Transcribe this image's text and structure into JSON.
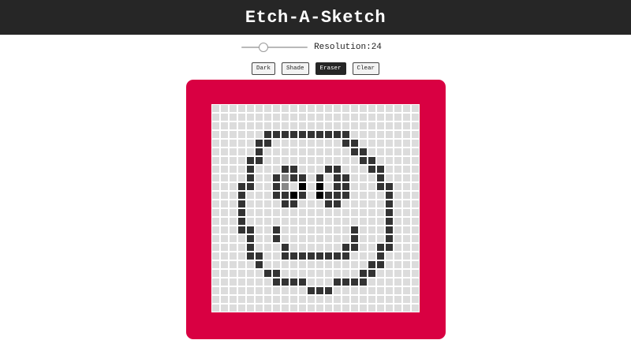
{
  "header": {
    "title": "Etch-A-Sketch"
  },
  "controls": {
    "resolution_label": "Resolution:",
    "resolution_value": "24",
    "resolution_level": 0.3
  },
  "modes": [
    {
      "id": "dark",
      "label": "Dark",
      "active": false
    },
    {
      "id": "shade",
      "label": "Shade",
      "active": false
    },
    {
      "id": "eraser",
      "label": "Eraser",
      "active": true
    },
    {
      "id": "clear",
      "label": "Clear",
      "active": false
    }
  ],
  "colors": {
    "header_bg": "#262626",
    "frame": "#d90042",
    "cell_empty": "#dcdcdc",
    "cell_dark": "#333333",
    "cell_black": "#000000",
    "cell_gray": "#888888"
  },
  "canvas": {
    "grid_size": 24,
    "painted": [
      [
        3,
        6,
        "#333333"
      ],
      [
        3,
        7,
        "#333333"
      ],
      [
        3,
        8,
        "#333333"
      ],
      [
        3,
        9,
        "#333333"
      ],
      [
        3,
        10,
        "#333333"
      ],
      [
        3,
        11,
        "#333333"
      ],
      [
        3,
        12,
        "#333333"
      ],
      [
        3,
        13,
        "#333333"
      ],
      [
        3,
        14,
        "#333333"
      ],
      [
        3,
        15,
        "#333333"
      ],
      [
        4,
        5,
        "#333333"
      ],
      [
        4,
        6,
        "#333333"
      ],
      [
        4,
        15,
        "#333333"
      ],
      [
        4,
        16,
        "#333333"
      ],
      [
        5,
        5,
        "#333333"
      ],
      [
        5,
        16,
        "#333333"
      ],
      [
        5,
        17,
        "#333333"
      ],
      [
        6,
        4,
        "#333333"
      ],
      [
        6,
        5,
        "#333333"
      ],
      [
        6,
        17,
        "#333333"
      ],
      [
        6,
        18,
        "#333333"
      ],
      [
        7,
        4,
        "#333333"
      ],
      [
        7,
        8,
        "#333333"
      ],
      [
        7,
        9,
        "#333333"
      ],
      [
        7,
        13,
        "#333333"
      ],
      [
        7,
        14,
        "#333333"
      ],
      [
        7,
        18,
        "#333333"
      ],
      [
        7,
        19,
        "#333333"
      ],
      [
        8,
        4,
        "#333333"
      ],
      [
        8,
        7,
        "#333333"
      ],
      [
        8,
        8,
        "#888888"
      ],
      [
        8,
        9,
        "#333333"
      ],
      [
        8,
        10,
        "#333333"
      ],
      [
        8,
        12,
        "#333333"
      ],
      [
        8,
        14,
        "#333333"
      ],
      [
        8,
        15,
        "#333333"
      ],
      [
        8,
        19,
        "#333333"
      ],
      [
        9,
        3,
        "#333333"
      ],
      [
        9,
        4,
        "#333333"
      ],
      [
        9,
        7,
        "#333333"
      ],
      [
        9,
        8,
        "#888888"
      ],
      [
        9,
        10,
        "#000000"
      ],
      [
        9,
        12,
        "#000000"
      ],
      [
        9,
        14,
        "#333333"
      ],
      [
        9,
        15,
        "#333333"
      ],
      [
        9,
        19,
        "#333333"
      ],
      [
        9,
        20,
        "#333333"
      ],
      [
        10,
        3,
        "#333333"
      ],
      [
        10,
        7,
        "#333333"
      ],
      [
        10,
        8,
        "#333333"
      ],
      [
        10,
        9,
        "#000000"
      ],
      [
        10,
        10,
        "#333333"
      ],
      [
        10,
        12,
        "#000000"
      ],
      [
        10,
        13,
        "#333333"
      ],
      [
        10,
        14,
        "#333333"
      ],
      [
        10,
        15,
        "#333333"
      ],
      [
        10,
        20,
        "#333333"
      ],
      [
        11,
        3,
        "#333333"
      ],
      [
        11,
        8,
        "#333333"
      ],
      [
        11,
        9,
        "#333333"
      ],
      [
        11,
        13,
        "#333333"
      ],
      [
        11,
        14,
        "#333333"
      ],
      [
        11,
        20,
        "#333333"
      ],
      [
        12,
        3,
        "#333333"
      ],
      [
        12,
        20,
        "#333333"
      ],
      [
        13,
        3,
        "#333333"
      ],
      [
        13,
        20,
        "#333333"
      ],
      [
        14,
        3,
        "#333333"
      ],
      [
        14,
        4,
        "#333333"
      ],
      [
        14,
        7,
        "#333333"
      ],
      [
        14,
        16,
        "#333333"
      ],
      [
        14,
        20,
        "#333333"
      ],
      [
        15,
        4,
        "#333333"
      ],
      [
        15,
        7,
        "#333333"
      ],
      [
        15,
        16,
        "#333333"
      ],
      [
        15,
        20,
        "#333333"
      ],
      [
        16,
        4,
        "#333333"
      ],
      [
        16,
        8,
        "#333333"
      ],
      [
        16,
        15,
        "#333333"
      ],
      [
        16,
        16,
        "#333333"
      ],
      [
        16,
        19,
        "#333333"
      ],
      [
        16,
        20,
        "#333333"
      ],
      [
        17,
        4,
        "#333333"
      ],
      [
        17,
        5,
        "#333333"
      ],
      [
        17,
        8,
        "#333333"
      ],
      [
        17,
        9,
        "#333333"
      ],
      [
        17,
        10,
        "#333333"
      ],
      [
        17,
        11,
        "#333333"
      ],
      [
        17,
        12,
        "#333333"
      ],
      [
        17,
        13,
        "#333333"
      ],
      [
        17,
        14,
        "#333333"
      ],
      [
        17,
        15,
        "#333333"
      ],
      [
        17,
        19,
        "#333333"
      ],
      [
        18,
        5,
        "#333333"
      ],
      [
        18,
        18,
        "#333333"
      ],
      [
        18,
        19,
        "#333333"
      ],
      [
        19,
        6,
        "#333333"
      ],
      [
        19,
        7,
        "#333333"
      ],
      [
        19,
        17,
        "#333333"
      ],
      [
        19,
        18,
        "#333333"
      ],
      [
        20,
        7,
        "#333333"
      ],
      [
        20,
        8,
        "#333333"
      ],
      [
        20,
        9,
        "#333333"
      ],
      [
        20,
        10,
        "#333333"
      ],
      [
        20,
        14,
        "#333333"
      ],
      [
        20,
        15,
        "#333333"
      ],
      [
        20,
        16,
        "#333333"
      ],
      [
        20,
        17,
        "#333333"
      ],
      [
        21,
        11,
        "#333333"
      ],
      [
        21,
        12,
        "#333333"
      ],
      [
        21,
        13,
        "#333333"
      ]
    ]
  }
}
